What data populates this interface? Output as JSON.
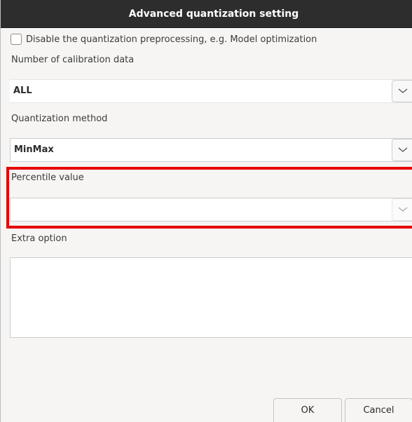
{
  "dialog": {
    "title": "Advanced quantization setting"
  },
  "preprocessing": {
    "checkbox_label": "Disable the quantization preprocessing, e.g. Model optimization",
    "checked": false
  },
  "calibration": {
    "label": "Number of calibration data",
    "value": "ALL",
    "icon": "chevron-down-icon"
  },
  "method": {
    "label": "Quantization method",
    "value": "MinMax",
    "icon": "chevron-down-icon"
  },
  "percentile": {
    "label": "Percentile value",
    "value": "",
    "icon": "chevron-down-icon",
    "highlight_color": "#e60000"
  },
  "extra": {
    "label": "Extra option",
    "value": ""
  },
  "buttons": {
    "ok_label": "OK",
    "cancel_label": "Cancel"
  }
}
